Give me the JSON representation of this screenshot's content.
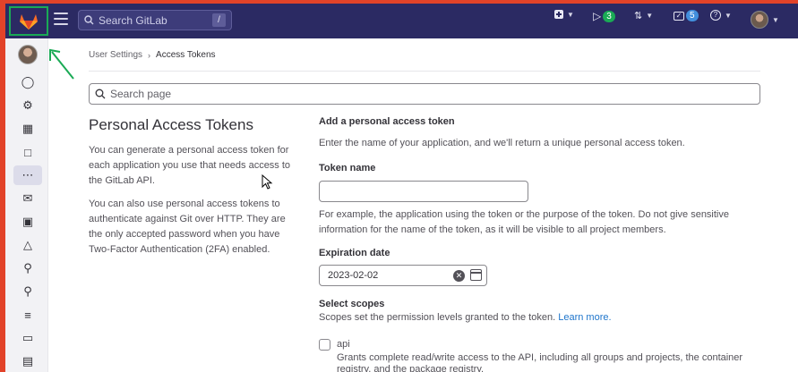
{
  "topbar": {
    "search_placeholder": "Search GitLab",
    "search_shortcut": "/",
    "issues_count": "3",
    "todos_count": "5"
  },
  "breadcrumb": {
    "parent": "User Settings",
    "current": "Access Tokens"
  },
  "page_search": {
    "placeholder": "Search page"
  },
  "left": {
    "title": "Personal Access Tokens",
    "desc1": "You can generate a personal access token for each application you use that needs access to the GitLab API.",
    "desc2": "You can also use personal access tokens to authenticate against Git over HTTP. They are the only accepted password when you have Two-Factor Authentication (2FA) enabled."
  },
  "form": {
    "heading": "Add a personal access token",
    "intro": "Enter the name of your application, and we'll return a unique personal access token.",
    "token_name_label": "Token name",
    "token_name_value": "",
    "token_help": "For example, the application using the token or the purpose of the token. Do not give sensitive information for the name of the token, as it will be visible to all project members.",
    "expiration_label": "Expiration date",
    "expiration_value": "2023-02-02",
    "scopes_label": "Select scopes",
    "scopes_help": "Scopes set the permission levels granted to the token.",
    "learn_more": "Learn more.",
    "scope_api_label": "api",
    "scope_api_desc": "Grants complete read/write access to the API, including all groups and projects, the container registry, and the package registry."
  },
  "colors": {
    "topbar": "#2b2a63",
    "frame": "#e24329",
    "highlight": "#1aaa55",
    "link": "#1f75cb"
  }
}
